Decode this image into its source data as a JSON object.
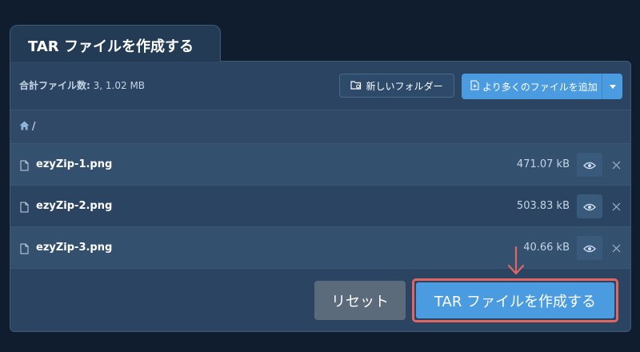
{
  "tab": {
    "title": "TAR ファイルを作成する"
  },
  "toolbar": {
    "summary_label": "合計ファイル数:",
    "summary_value": "3, 1.02 MB",
    "new_folder_label": "新しいフォルダー",
    "add_files_label": "より多くのファイルを追加"
  },
  "breadcrumb": {
    "root": "/"
  },
  "files": [
    {
      "name": "ezyZip-1.png",
      "size": "471.07 kB"
    },
    {
      "name": "ezyZip-2.png",
      "size": "503.83 kB"
    },
    {
      "name": "ezyZip-3.png",
      "size": "40.66 kB"
    }
  ],
  "footer": {
    "reset_label": "リセット",
    "create_label": "TAR ファイルを作成する"
  },
  "colors": {
    "background": "#0f1d2e",
    "panel": "#2b4462",
    "accent": "#4a9be0",
    "highlight": "#e06663",
    "reset": "#5b6b7b"
  },
  "icons": {
    "home": "home-icon",
    "folder": "new-folder-icon",
    "add": "add-file-icon",
    "file": "file-icon",
    "preview": "eye-icon",
    "remove": "close-icon",
    "annotation": "arrow-down-icon"
  }
}
